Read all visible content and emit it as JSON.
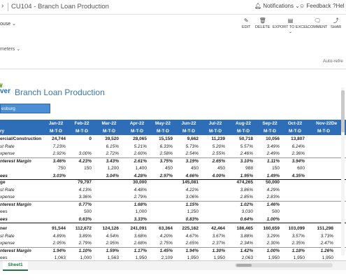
{
  "app": {
    "title": "CU104 - Branch Loan Production",
    "notifications": "Notifications",
    "feedback": "Feedback",
    "help": "Hel"
  },
  "toolbar": {
    "house": "ouse",
    "edit": "EDIT",
    "delete": "DELETE",
    "export": "EXPORT TO EXCEL",
    "comment": "COMMENT",
    "share": "SHAR"
  },
  "params_label": "meters",
  "auto_refresh": "Auto-refre",
  "report": {
    "logo": "ver",
    "title": "Branch Loan Production",
    "branch": "esburg"
  },
  "columns": [
    "Jan-22",
    "Feb-22",
    "Mar-22",
    "Apr-22",
    "May-22",
    "Jun-22",
    "Jul-22",
    "Aug-22",
    "Sep-22",
    "Oct-22",
    "Nov-22",
    "De"
  ],
  "mtd": "M-T-D",
  "row_header": "ry",
  "sections": [
    {
      "rows": [
        {
          "label": "ercial/Construction",
          "style": "b",
          "values": [
            "24,744",
            "0",
            "39,520",
            "28,065",
            "15,159",
            "9,662",
            "11,239",
            "50,718",
            "10,056",
            "13,807",
            "",
            ""
          ]
        },
        {
          "label": "st Rate",
          "style": "i",
          "values": [
            "7.23%",
            "",
            "6.15%",
            "5.21%",
            "6.33%",
            "5.73%",
            "5.20%",
            "5.57%",
            "3.49%",
            "6.24%",
            "",
            ""
          ]
        },
        {
          "label": "xpense",
          "style": "i",
          "values": [
            "2.92%",
            "3.00%",
            "2.72%",
            "2.60%",
            "2.58%",
            "2.54%",
            "2.55%",
            "2.46%",
            "2.49%",
            "2.36%",
            "",
            ""
          ]
        },
        {
          "label": "nterest Margin",
          "style": "bi",
          "values": [
            "3.46%",
            "4.23%",
            "3.43%",
            "2.61%",
            "3.75%",
            "3.19%",
            "2.65%",
            "3.10%",
            "1.11%",
            "3.94%",
            "",
            ""
          ]
        },
        {
          "label": "",
          "style": "",
          "values": [
            "750",
            "150",
            "1,200",
            "1,400",
            "450",
            "450",
            "450",
            "988",
            "150",
            "600",
            "",
            ""
          ]
        },
        {
          "label": "ees",
          "style": "bi",
          "values": [
            "3.03%",
            "",
            "3.04%",
            "4.28%",
            "2.97%",
            "4.66%",
            "4.00%",
            "1.95%",
            "1.49%",
            "4.35%",
            "",
            ""
          ]
        }
      ]
    },
    {
      "rows": [
        {
          "label": "ge",
          "style": "b",
          "values": [
            "",
            "79,797",
            "",
            "30,000",
            "",
            "145,081",
            "",
            "474,265",
            "50,000",
            "",
            "",
            ""
          ]
        },
        {
          "label": "st Rate",
          "style": "i",
          "values": [
            "",
            "4.13%",
            "",
            "4.48%",
            "",
            "4.22%",
            "",
            "3.86%",
            "4.29%",
            "",
            "",
            ""
          ]
        },
        {
          "label": "xpense",
          "style": "i",
          "values": [
            "",
            "3.36%",
            "",
            "2.79%",
            "",
            "3.06%",
            "",
            "2.85%",
            "2.83%",
            "",
            "",
            ""
          ]
        },
        {
          "label": "nterest Margin",
          "style": "bi",
          "values": [
            "",
            "0.77%",
            "",
            "1.68%",
            "",
            "1.15%",
            "",
            "1.02%",
            "1.46%",
            "",
            "",
            ""
          ]
        },
        {
          "label": "ees",
          "style": "",
          "values": [
            "",
            "500",
            "",
            "1,000",
            "",
            "1,250",
            "",
            "3,030",
            "500",
            "",
            "",
            ""
          ]
        },
        {
          "label": "ees",
          "style": "bi",
          "values": [
            "",
            "0.63%",
            "",
            "3.33%",
            "",
            "0.83%",
            "",
            "0.64%",
            "1.00%",
            "",
            "",
            ""
          ]
        }
      ]
    },
    {
      "rows": [
        {
          "label": "ner",
          "style": "b",
          "values": [
            "91,544",
            "112,672",
            "124,126",
            "241,091",
            "63,364",
            "225,162",
            "42,464",
            "186,465",
            "160,659",
            "103,099",
            "151,298",
            ""
          ]
        },
        {
          "label": "st Rate",
          "style": "i",
          "values": [
            "4.89%",
            "3.89%",
            "4.54%",
            "3.68%",
            "4.20%",
            "4.67%",
            "3.67%",
            "3.88%",
            "3.29%",
            "3.57%",
            "3.73%",
            ""
          ]
        },
        {
          "label": "xpense",
          "style": "i",
          "values": [
            "2.95%",
            "2.79%",
            "2.95%",
            "2.68%",
            "2.75%",
            "2.65%",
            "2.37%",
            "2.34%",
            "2.30%",
            "2.35%",
            "2.47%",
            ""
          ]
        },
        {
          "label": "nterest Margin",
          "style": "bi",
          "values": [
            "1.94%",
            "1.10%",
            "1.59%",
            "1.17%",
            "1.45%",
            "1.94%",
            "1.30%",
            "1.42%",
            "1.00%",
            "1.18%",
            "1.26%",
            ""
          ]
        },
        {
          "label": "ees",
          "style": "",
          "values": [
            "1,063",
            "1,000",
            "1,563",
            "1,950",
            "2,109",
            "1,950",
            "1,950",
            "2,063",
            "1,950",
            "1,950",
            "1,950",
            ""
          ]
        }
      ]
    }
  ],
  "sheet_tab": "Sheet1"
}
